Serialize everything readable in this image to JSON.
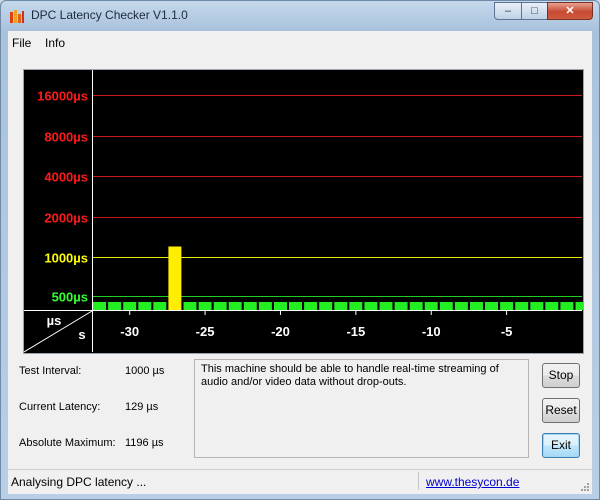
{
  "window": {
    "title": "DPC Latency Checker V1.1.0",
    "controls": [
      "minimize",
      "maximize",
      "close"
    ],
    "close_symbol": "✕",
    "minimize_symbol": "–",
    "maximize_symbol": "□"
  },
  "menu": {
    "items": [
      "File",
      "Info"
    ]
  },
  "chart_data": {
    "type": "bar",
    "y_labels": [
      {
        "text": "16000µs",
        "color": "#ff1a1a"
      },
      {
        "text": "8000µs",
        "color": "#ff1a1a"
      },
      {
        "text": "4000µs",
        "color": "#ff1a1a"
      },
      {
        "text": "2000µs",
        "color": "#ff1a1a"
      },
      {
        "text": "1000µs",
        "color": "#ffff00"
      },
      {
        "text": "500µs",
        "color": "#33ff33"
      }
    ],
    "y_ticks": [
      16000,
      8000,
      4000,
      2000,
      1000,
      500
    ],
    "corner_labels": {
      "y_unit": "µs",
      "x_unit": "s"
    },
    "x_ticks": [
      -30,
      -25,
      -20,
      -15,
      -10,
      -5
    ],
    "x_tick_labels": [
      "-30",
      "-25",
      "-20",
      "-15",
      "-10",
      "-5"
    ],
    "xlim": [
      -32.5,
      0
    ],
    "x": [
      -32,
      -31,
      -30,
      -29,
      -28,
      -27,
      -26,
      -25,
      -24,
      -23,
      -22,
      -21,
      -20,
      -19,
      -18,
      -17,
      -16,
      -15,
      -14,
      -13,
      -12,
      -11,
      -10,
      -9,
      -8,
      -7,
      -6,
      -5,
      -4,
      -3,
      -2,
      -1,
      0
    ],
    "values": [
      140,
      160,
      140,
      150,
      180,
      1196,
      150,
      160,
      180,
      150,
      140,
      150,
      160,
      160,
      130,
      170,
      140,
      140,
      140,
      140,
      150,
      140,
      170,
      150,
      150,
      140,
      140,
      160,
      140,
      140,
      150,
      160,
      150
    ],
    "colors": {
      "normal": "#22ee22",
      "warning": "#ffee00",
      "background": "#000000",
      "line_red": "#cc1a1a",
      "line_yellow": "#e8e800",
      "line_green": "#22cc22"
    },
    "scale": "log"
  },
  "params": [
    {
      "label": "Test Interval:",
      "value": "1000 µs"
    },
    {
      "label": "Current Latency:",
      "value": "129 µs"
    },
    {
      "label": "Absolute Maximum:",
      "value": "1196 µs"
    }
  ],
  "message": "This machine should be able to handle real-time streaming of audio and/or video data without drop-outs.",
  "buttons": {
    "stop": "Stop",
    "reset": "Reset",
    "exit": "Exit"
  },
  "status": {
    "text": "Analysing DPC latency ...",
    "link": "www.thesycon.de"
  }
}
